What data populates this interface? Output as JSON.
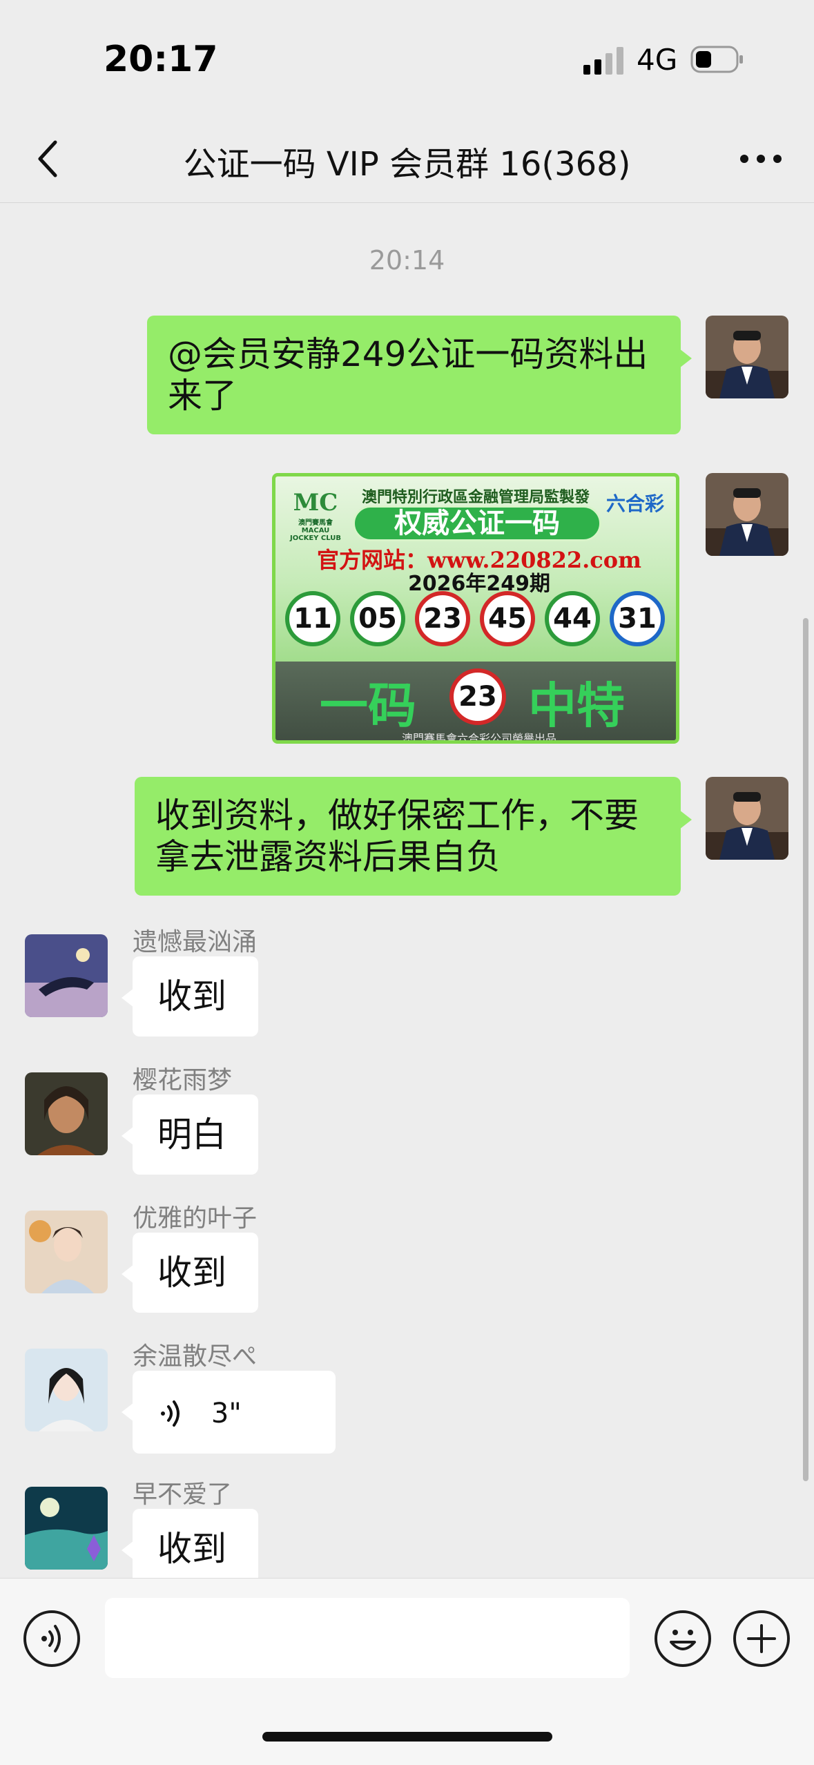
{
  "status_bar": {
    "time": "20:17",
    "network": "4G"
  },
  "nav": {
    "title": "公证一码 VIP 会员群 16(368)"
  },
  "chat": {
    "timestamp": "20:14",
    "msg1": "@会员安静249公证一码资料出来了",
    "poster": {
      "top_line": "澳門特別行政區金融管理局監製發行",
      "logo_text": "澳門賽馬會 MACAU JOCKEY CLUB",
      "badge": "六合彩",
      "pill": "权威公证一码",
      "site": "官方网站：www.220822.com",
      "period": "2026年249期",
      "balls": [
        "11",
        "05",
        "23",
        "45",
        "44",
        "31"
      ],
      "bottom_left": "一码",
      "bottom_ball": "23",
      "bottom_right": "中特",
      "footer": "澳門賽馬會六合彩公司榮譽出品"
    },
    "msg3": "收到资料，做好保密工作，不要拿去泄露资料后果自负",
    "members": [
      {
        "name": "遗憾最汹涌",
        "text": "收到"
      },
      {
        "name": "樱花雨梦",
        "text": "明白"
      },
      {
        "name": "优雅的叶子",
        "text": "收到"
      },
      {
        "name": "余温散尽ぺ",
        "text": "3\""
      },
      {
        "name": "早不爱了",
        "text": "收到"
      }
    ]
  },
  "colors": {
    "bubble_right": "#95ec69",
    "background": "#ededed",
    "poster_green": "#2fb14a",
    "ball_green": "#2c9b3a",
    "ball_red": "#d32828",
    "ball_blue": "#1e68c8"
  }
}
